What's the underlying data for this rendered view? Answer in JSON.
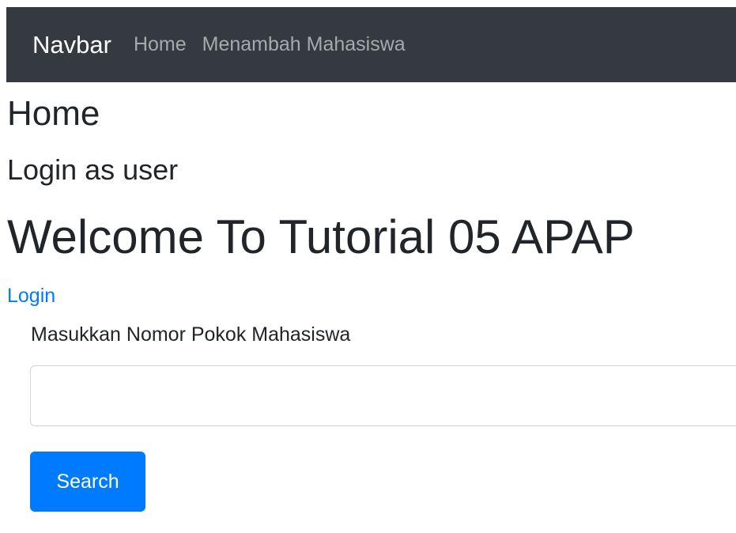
{
  "navbar": {
    "brand": "Navbar",
    "links": [
      {
        "label": "Home"
      },
      {
        "label": "Menambah Mahasiswa"
      }
    ]
  },
  "page": {
    "heading": "Home",
    "login_status": "Login as user",
    "welcome": "Welcome To Tutorial 05 APAP",
    "login_link": "Login"
  },
  "search_form": {
    "label": "Masukkan Nomor Pokok Mahasiswa",
    "input_value": "",
    "input_placeholder": "",
    "submit_label": "Search"
  },
  "colors": {
    "navbar_bg": "#343a40",
    "primary": "#007bff",
    "nav_link": "#a7a9ab"
  }
}
